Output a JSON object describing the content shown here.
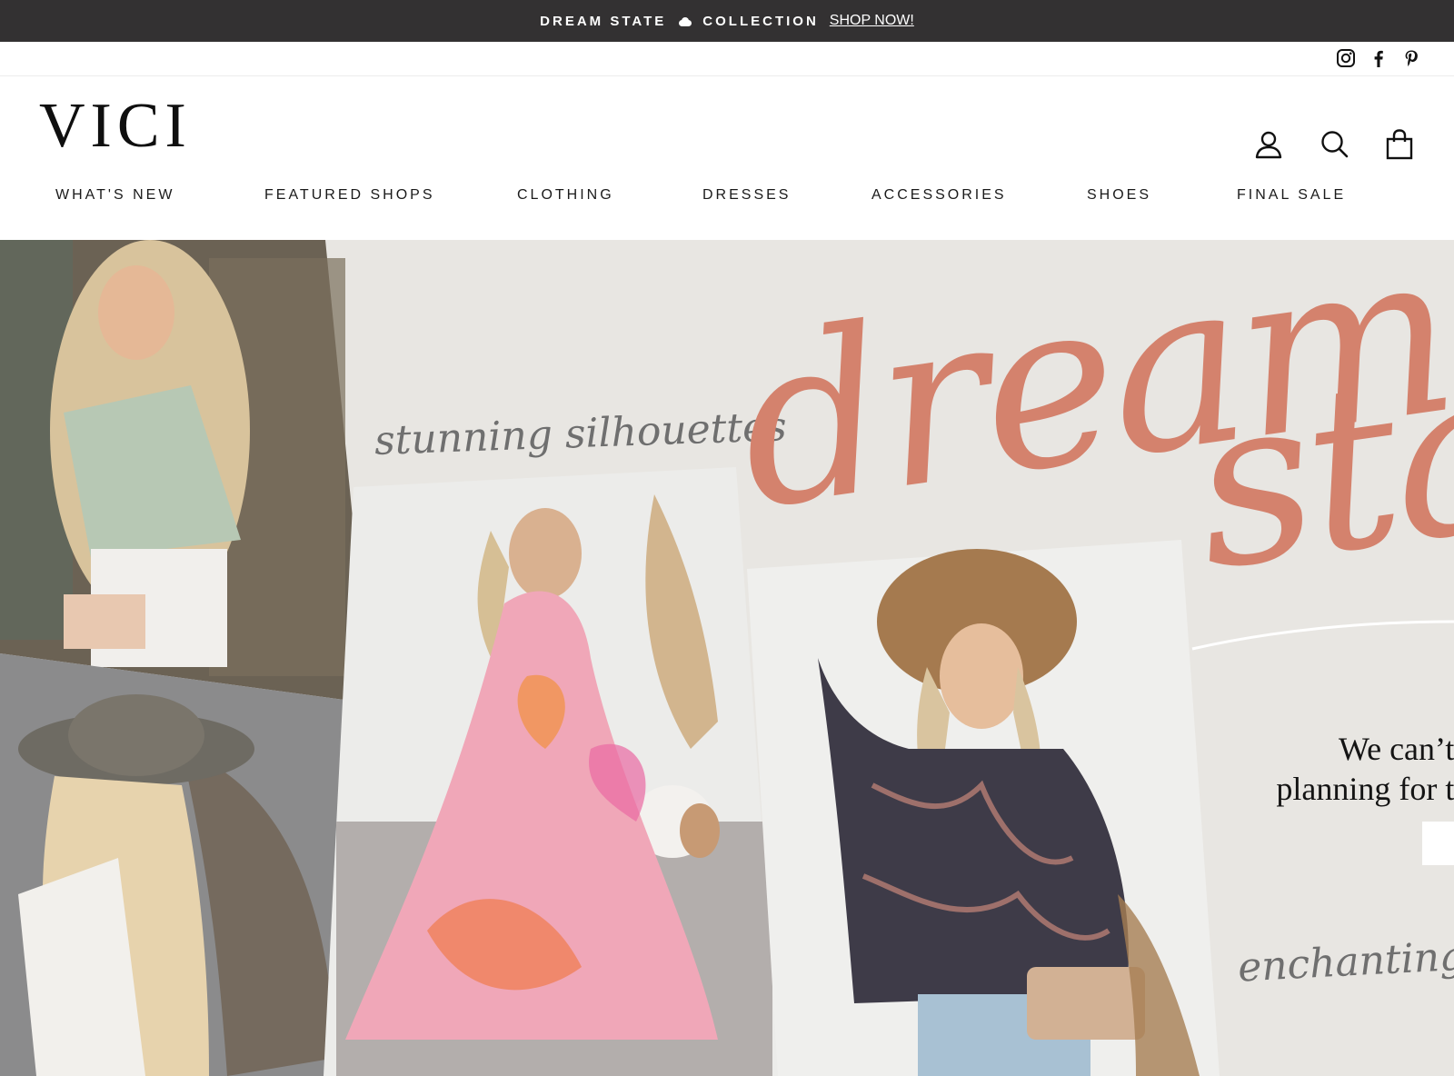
{
  "announcement": {
    "text_before": "DREAM STATE",
    "text_after": "COLLECTION",
    "cta": "SHOP NOW!",
    "icon": "cloud-icon",
    "background": "#333132"
  },
  "social": {
    "icons": [
      "instagram-icon",
      "facebook-icon",
      "pinterest-icon"
    ]
  },
  "header": {
    "logo": "VICI",
    "icons": [
      "account-icon",
      "search-icon",
      "cart-bag-icon"
    ]
  },
  "nav": {
    "items": [
      "WHAT'S NEW",
      "FEATURED SHOPS",
      "CLOTHING",
      "DRESSES",
      "ACCESSORIES",
      "SHOES",
      "FINAL SALE"
    ]
  },
  "hero": {
    "script_left": "stunning silhouettes",
    "title_line1": "dream",
    "title_line2": "stat",
    "tagline_line1": "We can’t",
    "tagline_line2": "planning for t",
    "script_bottom": "enchanting p",
    "accent_color": "#d4826d",
    "background": "#e8e6e2"
  }
}
